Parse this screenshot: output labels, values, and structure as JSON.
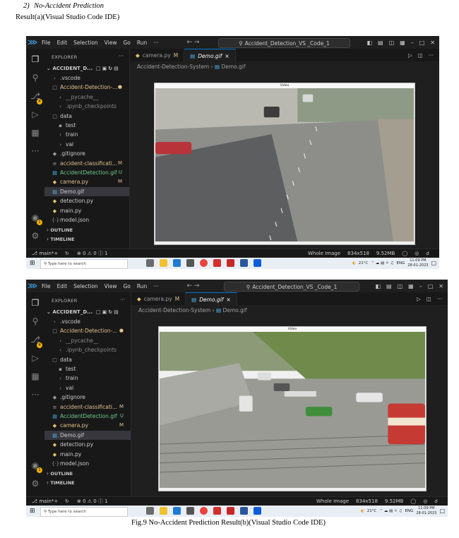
{
  "doc": {
    "heading_number": "2)",
    "heading_title": "No-Accident Prediction",
    "caption_a": "Result(a)(Visual Studio Code IDE)",
    "caption_b": "Fig.9 No-Accident Prediction Result(b)(Visual Studio Code IDE)"
  },
  "vscode": {
    "menu": [
      "File",
      "Edit",
      "Selection",
      "View",
      "Go",
      "Run",
      "···"
    ],
    "nav": "← →",
    "search_text": "Accident_Detection_VS _Code_1",
    "explorer_title": "EXPLORER",
    "explorer_dots": "···",
    "root_folder": "ACCIDENT_D...",
    "source_control_badge": "4",
    "accounts_badge": "1",
    "tree": [
      {
        "name": ".vscode",
        "icon": "›",
        "indent": 0,
        "color": "#cccccc",
        "status": ""
      },
      {
        "name": "Accident-Detection-...",
        "icon": "□",
        "indent": 0,
        "color": "#e2c08d",
        "status": "●"
      },
      {
        "name": "__pycache__",
        "icon": "›",
        "indent": 1,
        "color": "#8c8c8c",
        "status": ""
      },
      {
        "name": ".ipynb_checkpoints",
        "icon": "›",
        "indent": 1,
        "color": "#8c8c8c",
        "status": ""
      },
      {
        "name": "data",
        "icon": "□",
        "indent": 0,
        "color": "#cccccc",
        "status": ""
      },
      {
        "name": "test",
        "icon": "▪",
        "indent": 1,
        "color": "#cccccc",
        "status": ""
      },
      {
        "name": "train",
        "icon": "›",
        "indent": 1,
        "color": "#cccccc",
        "status": ""
      },
      {
        "name": "val",
        "icon": "›",
        "indent": 1,
        "color": "#cccccc",
        "status": ""
      },
      {
        "name": ".gitignore",
        "icon": "◆",
        "indent": 0,
        "color": "#cccccc",
        "status": ""
      },
      {
        "name": "accident-classificati...",
        "icon": "≡",
        "indent": 0,
        "color": "#e2c08d",
        "status": "M"
      },
      {
        "name": "AccidentDetection.gif",
        "icon": "▤",
        "indent": 0,
        "color": "#73c991",
        "status": "U"
      },
      {
        "name": "camera.py",
        "icon": "◆",
        "indent": 0,
        "color": "#e2c08d",
        "status": "M"
      },
      {
        "name": "Demo.gif",
        "icon": "▤",
        "indent": 0,
        "color": "#cccccc",
        "status": ""
      },
      {
        "name": "detection.py",
        "icon": "◆",
        "indent": 0,
        "color": "#cccccc",
        "status": ""
      },
      {
        "name": "main.py",
        "icon": "◆",
        "indent": 0,
        "color": "#cccccc",
        "status": ""
      },
      {
        "name": "model.json",
        "icon": "{·}",
        "indent": 0,
        "color": "#cccccc",
        "status": ""
      }
    ],
    "outline": "OUTLINE",
    "timeline": "TIMELINE",
    "tabs": [
      {
        "label": "camera.py",
        "mod": "M"
      },
      {
        "label": "Demo.gif",
        "mod": "×"
      }
    ],
    "breadcrumb_folder": "Accident-Detection-System",
    "breadcrumb_sep": "›",
    "breadcrumb_file": "Demo.gif",
    "video_title": "Video",
    "status_branch": "main*+",
    "status_problems": "⊗ 0 ⚠ 0 ⓘ 1",
    "status_image": "Whole Image",
    "status_dims": "834x518",
    "status_size": "9.52MB",
    "taskbar_search": "Type here to search",
    "weather": "21°C",
    "lang": "ENG",
    "time": "11:09 PM",
    "date": "28-01-2023"
  },
  "colors": {
    "accent": "#0078d4",
    "modified": "#e2c08d",
    "untracked": "#73c991",
    "badge": "#f2b200"
  }
}
